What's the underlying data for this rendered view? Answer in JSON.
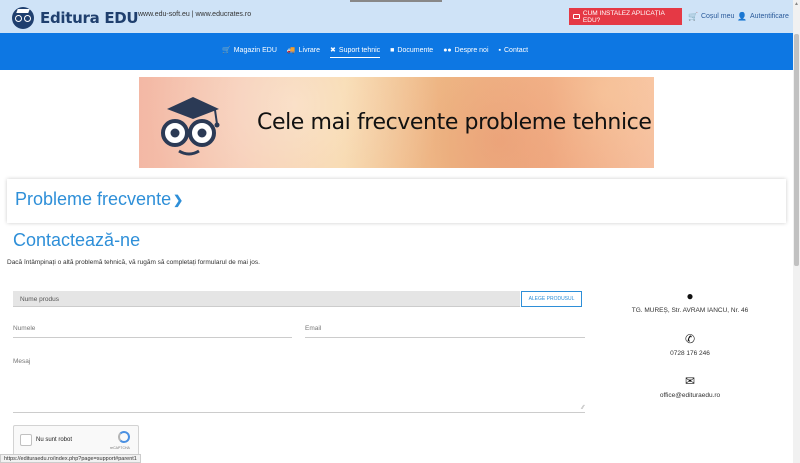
{
  "header": {
    "logo_text": "Editura EDU",
    "sites": "www.edu-soft.eu | www.educrates.ro",
    "install_label": "CUM INSTALEZ APLICAȚIA EDU?",
    "cart_label": "Coșul meu",
    "login_label": "Autentificare"
  },
  "nav": {
    "items": [
      {
        "label": "Magazin EDU",
        "icon": "cart-icon"
      },
      {
        "label": "Livrare",
        "icon": "truck-icon"
      },
      {
        "label": "Suport tehnic",
        "icon": "wrench-icon",
        "active": true
      },
      {
        "label": "Documente",
        "icon": "folder-icon"
      },
      {
        "label": "Despre noi",
        "icon": "users-icon"
      },
      {
        "label": "Contact",
        "icon": "contact-icon"
      }
    ]
  },
  "banner": {
    "text": "Cele mai frecvente probleme tehnice"
  },
  "faq": {
    "title": "Probleme frecvente"
  },
  "contact": {
    "title": "Contactează-ne",
    "intro": "Dacă întâmpinați o altă problemă tehnică, vă rugăm să completați formularul de mai jos.",
    "product_placeholder": "Nume produs",
    "choose_button": "ALEGE PRODUSUL",
    "name_placeholder": "Numele",
    "email_placeholder": "Email",
    "message_placeholder": "Mesaj",
    "captcha_label": "Nu sunt robot",
    "captcha_brand": "reCAPTCHA"
  },
  "info": {
    "address": "TG. MUREȘ, Str. AVRAM IANCU, Nr. 46",
    "phone": "0728 176 246",
    "email": "office@edituraedu.ro"
  },
  "status_url": "https://edituraedu.ro/index.php?page=support#parent1",
  "colors": {
    "nav_blue": "#0d77e3",
    "accent_blue": "#2e8fd8",
    "install_red": "#e53945",
    "top_bar": "#cfe3f7"
  }
}
